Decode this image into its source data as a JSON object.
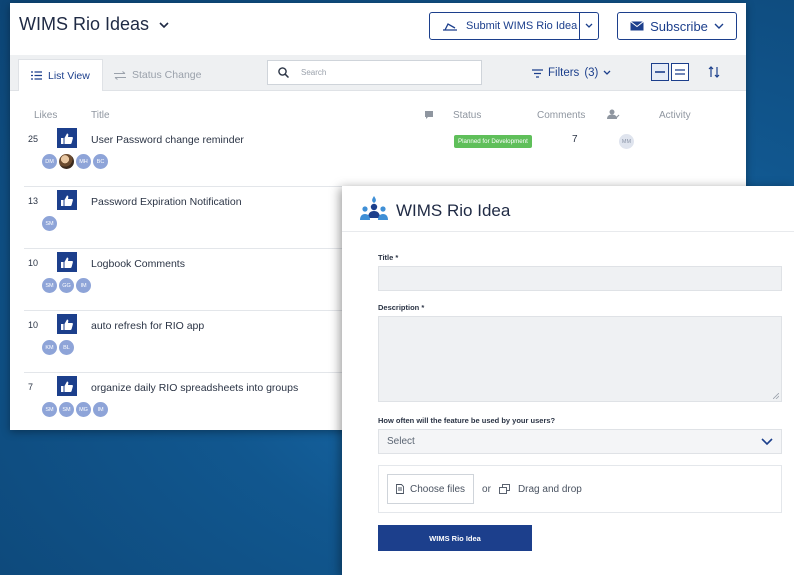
{
  "ideas": {
    "title": "WIMS Rio Ideas",
    "submit_label": "Submit WIMS Rio Idea",
    "subscribe_label": "Subscribe",
    "tabs": [
      {
        "label": "List View",
        "active": true,
        "icon": "list-icon"
      },
      {
        "label": "Status Change",
        "active": false,
        "icon": "swap-arrows-icon"
      }
    ],
    "search_placeholder": "Search",
    "filters_label": "Filters",
    "filters_count": "(3)",
    "columns": {
      "likes": "Likes",
      "title": "Title",
      "status": "Status",
      "comments": "Comments",
      "activity": "Activity"
    },
    "rows": [
      {
        "likes": "25",
        "title": "User Password change reminder",
        "status": "Planned for Development",
        "comments": "7",
        "assignee": "MM",
        "avatars": [
          "DM",
          "",
          "MH",
          "BC"
        ]
      },
      {
        "likes": "13",
        "title": "Password Expiration Notification",
        "avatars": [
          "SM"
        ]
      },
      {
        "likes": "10",
        "title": "Logbook Comments",
        "avatars": [
          "SM",
          "GG",
          "IM"
        ]
      },
      {
        "likes": "10",
        "title": "auto refresh for RIO app",
        "avatars": [
          "KM",
          "BL"
        ]
      },
      {
        "likes": "7",
        "title": "organize daily RIO spreadsheets into groups",
        "avatars": [
          "SM",
          "SM",
          "MG",
          "IM"
        ]
      }
    ],
    "colors": {
      "accent": "#1c3f8c",
      "status_green": "#5fbf5a"
    }
  },
  "form": {
    "title": "WIMS Rio Idea",
    "title_label": "Title *",
    "description_label": "Description *",
    "frequency_label": "How often will the feature be used by your users?",
    "frequency_value": "Select",
    "choose_files": "Choose files",
    "or_text": "or",
    "drag_drop": "Drag and drop",
    "submit_label": "WIMS Rio Idea"
  }
}
